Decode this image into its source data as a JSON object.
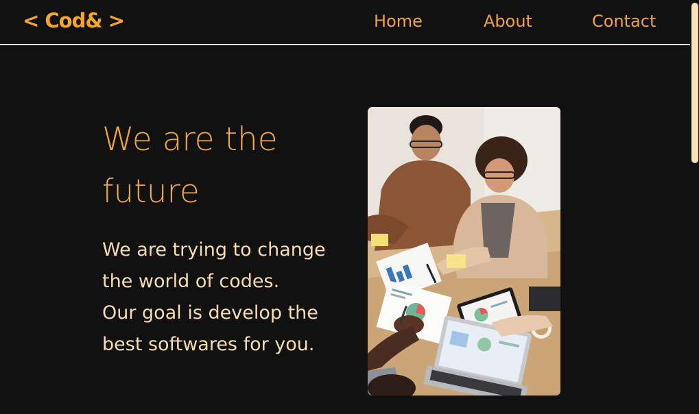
{
  "brand": {
    "logo_text": "< Cod& >"
  },
  "nav": {
    "items": [
      {
        "label": "Home"
      },
      {
        "label": "About"
      },
      {
        "label": "Contact"
      }
    ]
  },
  "hero": {
    "title": "We are the future",
    "description_lines": [
      "We are trying to change",
      "the world of codes.",
      "Our goal is develop the",
      "best softwares for you."
    ],
    "image_subject": "team meeting around a table with laptop and charts"
  },
  "colors": {
    "background": "#121112",
    "accent": "#f5a623",
    "text_light": "#f8ddb2",
    "scrollbar_thumb": "#f6e1b8"
  }
}
